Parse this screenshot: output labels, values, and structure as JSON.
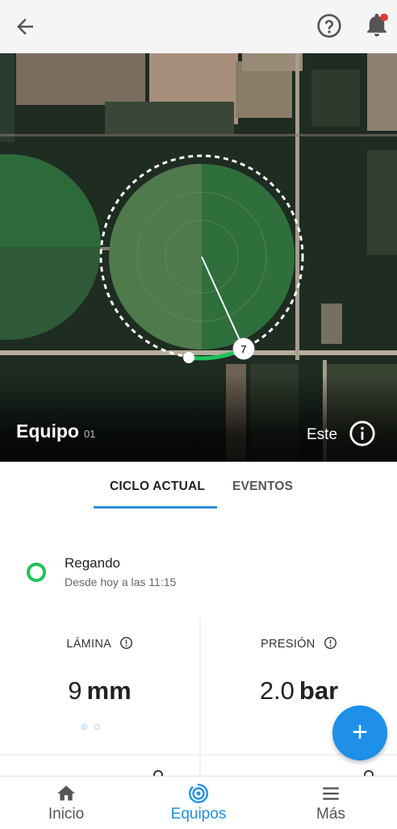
{
  "header": {
    "back_icon": "arrow-left-icon",
    "help_icon": "help-circle-icon",
    "notifications_icon": "bell-icon",
    "notification_dot_color": "#e53935"
  },
  "map": {
    "title": "Equipo",
    "subtitle": "01",
    "direction": "Este",
    "info_icon": "info-circle-icon",
    "pivot_marker_label": "7"
  },
  "tabs": [
    {
      "label": "CICLO ACTUAL",
      "active": true
    },
    {
      "label": "EVENTOS",
      "active": false
    }
  ],
  "status": {
    "title": "Regando",
    "subtitle": "Desde hoy a las 11:15",
    "color": "#1fc35a"
  },
  "metrics": [
    {
      "label": "LÁMINA",
      "value": "9",
      "unit": "mm",
      "info_icon": "info-circle-icon"
    },
    {
      "label": "PRESIÓN",
      "value": "2.0",
      "unit": "bar",
      "info_icon": "info-circle-icon"
    }
  ],
  "fab": {
    "label": "+",
    "icon": "plus-icon"
  },
  "bottom_nav": [
    {
      "label": "Inicio",
      "icon": "home-icon",
      "active": false
    },
    {
      "label": "Equipos",
      "icon": "pivot-icon",
      "active": true
    },
    {
      "label": "Más",
      "icon": "menu-icon",
      "active": false
    }
  ],
  "colors": {
    "accent": "#1e90e8",
    "tab_underline": "#2d8fd5",
    "status_green": "#1fc35a"
  }
}
